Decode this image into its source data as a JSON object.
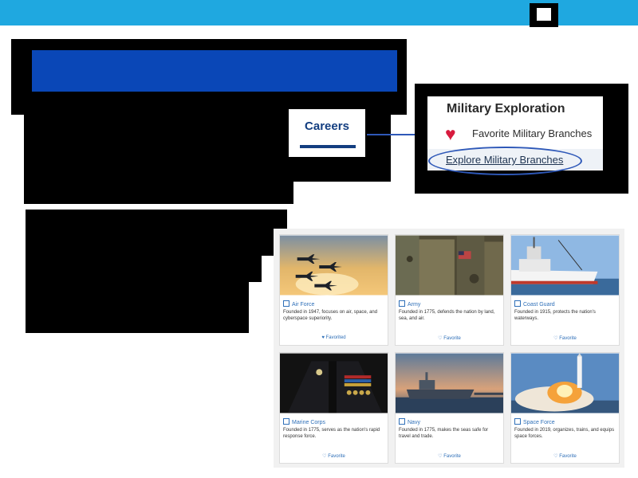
{
  "colors": {
    "topbar": "#1fa8e0",
    "banner": "#0a47b7",
    "careers_accent": "#133e80",
    "heart": "#d81b3e",
    "circle": "#2e58b8"
  },
  "nav": {
    "careers_label": "Careers"
  },
  "military_menu": {
    "title": "Military Exploration",
    "items": [
      {
        "icon": "heart-icon",
        "label": "Favorite Military Branches"
      },
      {
        "label": "Explore Military Branches"
      }
    ]
  },
  "cards": [
    {
      "title": "Air Force",
      "description": "Founded in 1947, focuses on air, space, and cyberspace superiority.",
      "favorite_label": "Favorited",
      "favorited": true
    },
    {
      "title": "Army",
      "description": "Founded in 1775, defends the nation by land, sea, and air.",
      "favorite_label": "Favorite",
      "favorited": false
    },
    {
      "title": "Coast Guard",
      "description": "Founded in 1915, protects the nation's waterways.",
      "favorite_label": "Favorite",
      "favorited": false
    },
    {
      "title": "Marine Corps",
      "description": "Founded in 1775, serves as the nation's rapid response force.",
      "favorite_label": "Favorite",
      "favorited": false
    },
    {
      "title": "Navy",
      "description": "Founded in 1775, makes the seas safe for travel and trade.",
      "favorite_label": "Favorite",
      "favorited": false
    },
    {
      "title": "Space Force",
      "description": "Founded in 2019, organizes, trains, and equips space forces.",
      "favorite_label": "Favorite",
      "favorited": false
    }
  ]
}
